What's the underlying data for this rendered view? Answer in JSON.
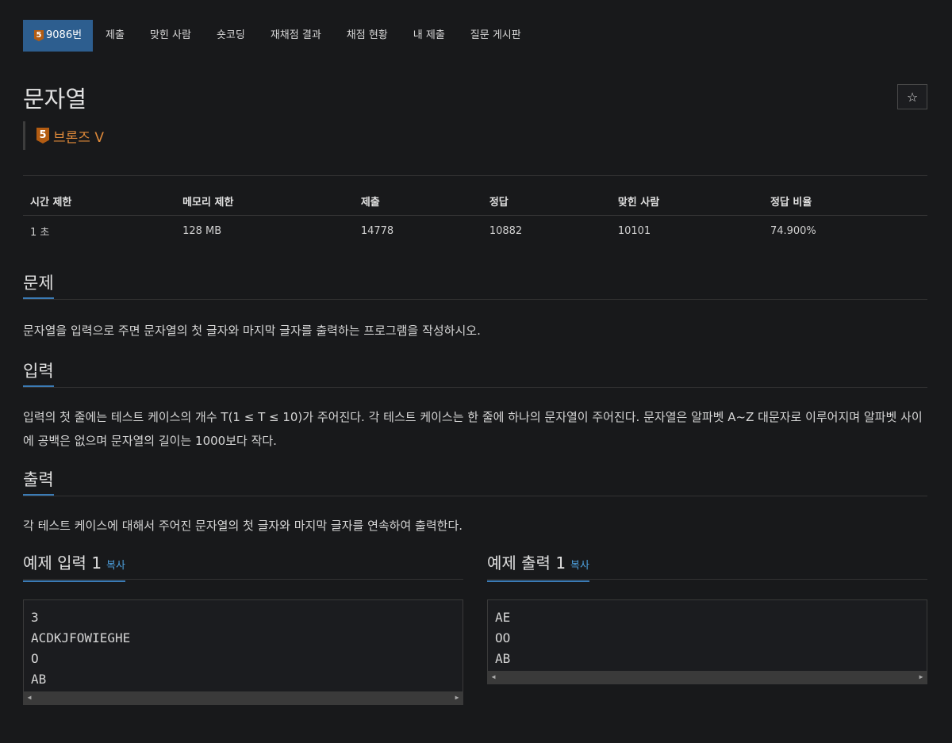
{
  "nav": {
    "problem_tab": {
      "badge": "5",
      "label": "9086번"
    },
    "tabs": [
      "제출",
      "맞힌 사람",
      "숏코딩",
      "재채점 결과",
      "채점 현황",
      "내 제출",
      "질문 게시판"
    ]
  },
  "problem": {
    "title": "문자열",
    "star_icon": "☆",
    "tier_badge": "5",
    "tier_label": "브론즈 V"
  },
  "info_table": {
    "headers": [
      "시간 제한",
      "메모리 제한",
      "제출",
      "정답",
      "맞힌 사람",
      "정답 비율"
    ],
    "values": [
      "1 초",
      "128 MB",
      "14778",
      "10882",
      "10101",
      "74.900%"
    ]
  },
  "sections": {
    "problem": {
      "heading": "문제",
      "text": "문자열을 입력으로 주면 문자열의 첫 글자와 마지막 글자를 출력하는 프로그램을 작성하시오."
    },
    "input": {
      "heading": "입력",
      "text": "입력의 첫 줄에는 테스트 케이스의 개수 T(1 ≤ T ≤ 10)가 주어진다. 각 테스트 케이스는 한 줄에 하나의 문자열이 주어진다. 문자열은 알파벳 A~Z 대문자로 이루어지며 알파벳 사이에 공백은 없으며 문자열의 길이는 1000보다 작다."
    },
    "output": {
      "heading": "출력",
      "text": "각 테스트 케이스에 대해서 주어진 문자열의 첫 글자와 마지막 글자를 연속하여 출력한다."
    }
  },
  "samples": {
    "input": {
      "heading": "예제 입력 1",
      "copy": "복사",
      "lines": [
        "3",
        "ACDKJFOWIEGHE",
        "O",
        "AB"
      ]
    },
    "output": {
      "heading": "예제 출력 1",
      "copy": "복사",
      "lines": [
        "AE",
        "OO",
        "AB"
      ]
    },
    "scroll_left": "◀",
    "scroll_right": "▶"
  },
  "colors": {
    "accent": "#2d5e8f",
    "tier": "#e08a3a",
    "link": "#4d9fdc"
  }
}
